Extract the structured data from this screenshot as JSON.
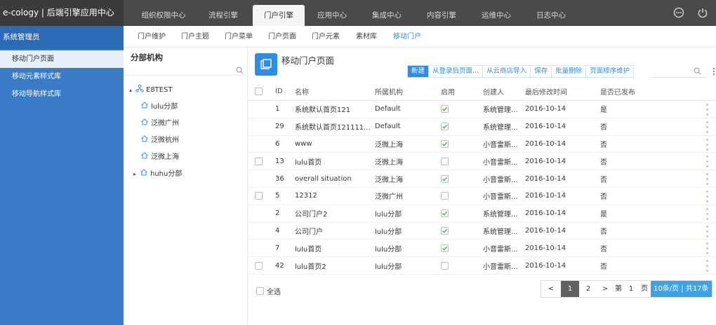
{
  "app": {
    "title": "e-cology | 后端引擎应用中心"
  },
  "top_nav": {
    "tabs": [
      "组织权限中心",
      "流程引擎",
      "门户引擎",
      "应用中心",
      "集成中心",
      "内容引擎",
      "运维中心",
      "日志中心"
    ],
    "active": "门户引擎",
    "icons": [
      "more-circle-icon",
      "power-icon"
    ]
  },
  "left_nav": {
    "header": "系统管理员",
    "items": [
      "移动门户页面",
      "移动元素样式库",
      "移动导航样式库"
    ],
    "active": "移动门户页面"
  },
  "sub_nav": {
    "tabs": [
      "门户维护",
      "门户主题",
      "门户菜单",
      "门户页面",
      "门户元素",
      "素材库",
      "移动门户"
    ],
    "active": "移动门户"
  },
  "org_panel": {
    "title": "分部机构",
    "search_placeholder": "",
    "root": "E8TEST",
    "children": [
      "lulu分部",
      "泛微广州",
      "泛微杭州",
      "泛微上海",
      "huhu分部"
    ]
  },
  "main": {
    "heading": "移动门户页面",
    "toolbar": [
      "新建",
      "从登录后页面...",
      "从云商店导入",
      "保存",
      "批量删除",
      "页面顺序维护"
    ],
    "search_placeholder": "",
    "columns": [
      "ID",
      "名称",
      "所属机构",
      "启用",
      "创建人",
      "最后修改时间",
      "是否已发布"
    ],
    "rows": [
      {
        "id": "1",
        "name": "系统默认首页121",
        "org": "Default",
        "enabled": true,
        "creator": "系统管理...",
        "modified": "2016-10-14",
        "published": "是",
        "selectable": false
      },
      {
        "id": "29",
        "name": "系统默认首页121111...",
        "org": "Default",
        "enabled": true,
        "creator": "系统管理...",
        "modified": "2016-10-14",
        "published": "否",
        "selectable": false
      },
      {
        "id": "6",
        "name": "www",
        "org": "泛微上海",
        "enabled": true,
        "creator": "小音雷斯...",
        "modified": "2016-10-14",
        "published": "否",
        "selectable": false
      },
      {
        "id": "13",
        "name": "lulu首页",
        "org": "泛微上海",
        "enabled": false,
        "creator": "小音雷斯...",
        "modified": "2016-10-14",
        "published": "否",
        "selectable": true
      },
      {
        "id": "36",
        "name": "overall situation",
        "org": "泛微上海",
        "enabled": true,
        "creator": "小音雷斯...",
        "modified": "2016-10-14",
        "published": "否",
        "selectable": false
      },
      {
        "id": "5",
        "name": "12312",
        "org": "泛微广州",
        "enabled": false,
        "creator": "小音雷斯...",
        "modified": "2016-10-14",
        "published": "否",
        "selectable": true
      },
      {
        "id": "2",
        "name": "公司门户2",
        "org": "lulu分部",
        "enabled": true,
        "creator": "系统管理...",
        "modified": "2016-10-14",
        "published": "是",
        "selectable": false
      },
      {
        "id": "4",
        "name": "公司门户",
        "org": "lulu分部",
        "enabled": true,
        "creator": "系统管理...",
        "modified": "2016-10-14",
        "published": "否",
        "selectable": false
      },
      {
        "id": "7",
        "name": "lulu首页",
        "org": "lulu分部",
        "enabled": true,
        "creator": "小音雷斯...",
        "modified": "2016-10-14",
        "published": "否",
        "selectable": false
      },
      {
        "id": "42",
        "name": "lulu首页2",
        "org": "lulu分部",
        "enabled": false,
        "creator": "小音雷斯...",
        "modified": "2016-10-14",
        "published": "否",
        "selectable": true
      }
    ],
    "select_all": "全选",
    "pager": {
      "prev": "<",
      "pages": [
        "1",
        "2"
      ],
      "current": "1",
      "next": ">",
      "goto_prefix": "第",
      "goto_value": "1",
      "goto_suffix": "页",
      "info": "10条/页 | 共17条"
    }
  },
  "colors": {
    "brand_blue": "#2e8ee6",
    "nav_blue": "#3a7bc8",
    "topbar": "#4a4a4a",
    "check_green": "#4caf50"
  }
}
